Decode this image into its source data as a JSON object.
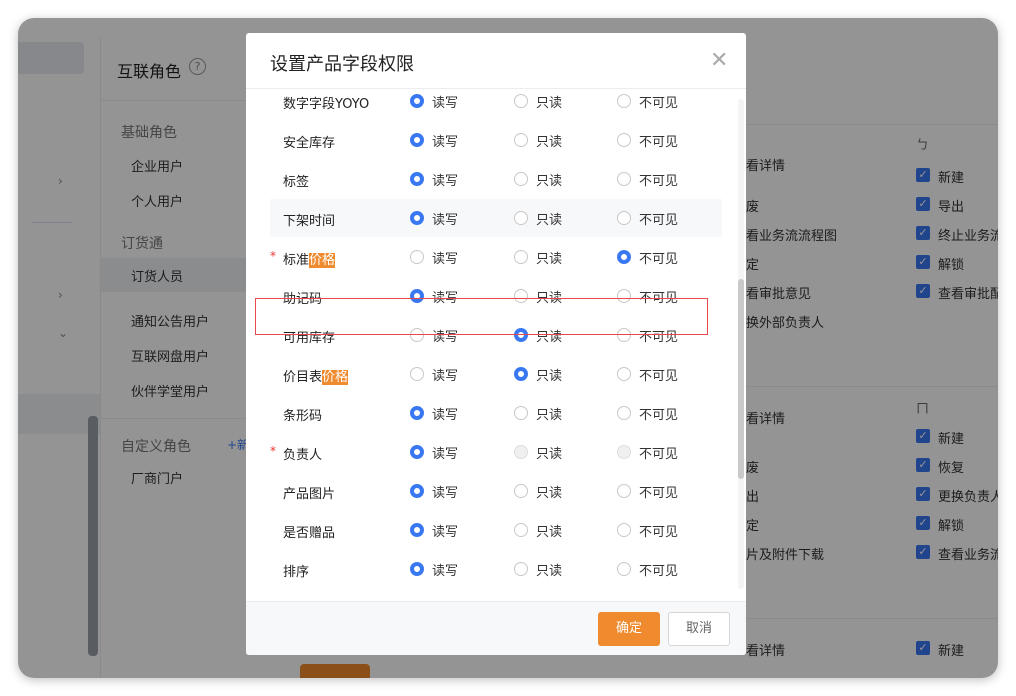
{
  "background": {
    "role_panel": {
      "title": "互联角色",
      "help_icon": "?",
      "groups": [
        {
          "label": "基础角色",
          "items": [
            "企业用户",
            "个人用户"
          ]
        },
        {
          "label": "订货通",
          "items": [
            "订货人员",
            "通知公告用户",
            "互联网盘用户",
            "伙伴学堂用户"
          ]
        },
        {
          "label": "自定义角色",
          "add_label": "+新",
          "items": [
            "厂商门户"
          ]
        }
      ]
    },
    "permissions_area": {
      "block1_left": [
        "看详情",
        "废",
        "看业务流流程图",
        "定",
        "看审批意见",
        "换外部负责人"
      ],
      "block1_right_header": "ㄅ",
      "block1_right": [
        "新建",
        "导出",
        "终止业务流",
        "解锁",
        "查看审批配"
      ],
      "block2_left": [
        "看详情",
        "废",
        "出",
        "定",
        "片及附件下载"
      ],
      "block2_right_header": "ㄇ",
      "block2_right": [
        "新建",
        "恢复",
        "更换负责人",
        "解锁",
        "查看业务流"
      ],
      "block3_left": [
        "看详情"
      ],
      "block3_right": [
        "新建"
      ]
    }
  },
  "modal": {
    "title": "设置产品字段权限",
    "close_icon": "close-icon",
    "option_labels": [
      "读写",
      "只读",
      "不可见"
    ],
    "fields": [
      {
        "prefix": "数字字段YOYO",
        "mark": "",
        "required": false,
        "selected": 0,
        "disabled": []
      },
      {
        "prefix": "安全库存",
        "mark": "",
        "required": false,
        "selected": 0,
        "disabled": []
      },
      {
        "prefix": "标签",
        "mark": "",
        "required": false,
        "selected": 0,
        "disabled": []
      },
      {
        "prefix": "下架时间",
        "mark": "",
        "required": false,
        "selected": 0,
        "disabled": []
      },
      {
        "prefix": "标准",
        "mark": "价格",
        "required": true,
        "selected": 2,
        "disabled": []
      },
      {
        "prefix": "助记码",
        "mark": "",
        "required": false,
        "selected": 0,
        "disabled": []
      },
      {
        "prefix": "可用库存",
        "mark": "",
        "required": false,
        "selected": 1,
        "disabled": []
      },
      {
        "prefix": "价目表",
        "mark": "价格",
        "required": false,
        "selected": 1,
        "disabled": []
      },
      {
        "prefix": "条形码",
        "mark": "",
        "required": false,
        "selected": 0,
        "disabled": []
      },
      {
        "prefix": "负责人",
        "mark": "",
        "required": true,
        "selected": 0,
        "disabled": [
          1,
          2
        ]
      },
      {
        "prefix": "产品图片",
        "mark": "",
        "required": false,
        "selected": 0,
        "disabled": []
      },
      {
        "prefix": "是否赠品",
        "mark": "",
        "required": false,
        "selected": 0,
        "disabled": []
      },
      {
        "prefix": "排序",
        "mark": "",
        "required": false,
        "selected": 0,
        "disabled": []
      }
    ],
    "required_mark": "*",
    "highlighted_field": "标准价格",
    "ok_label": "确定",
    "cancel_label": "取消"
  },
  "colors": {
    "accent": "#f08a2e",
    "radio_selected": "#3a78f2",
    "highlight_border": "#e5484d"
  }
}
